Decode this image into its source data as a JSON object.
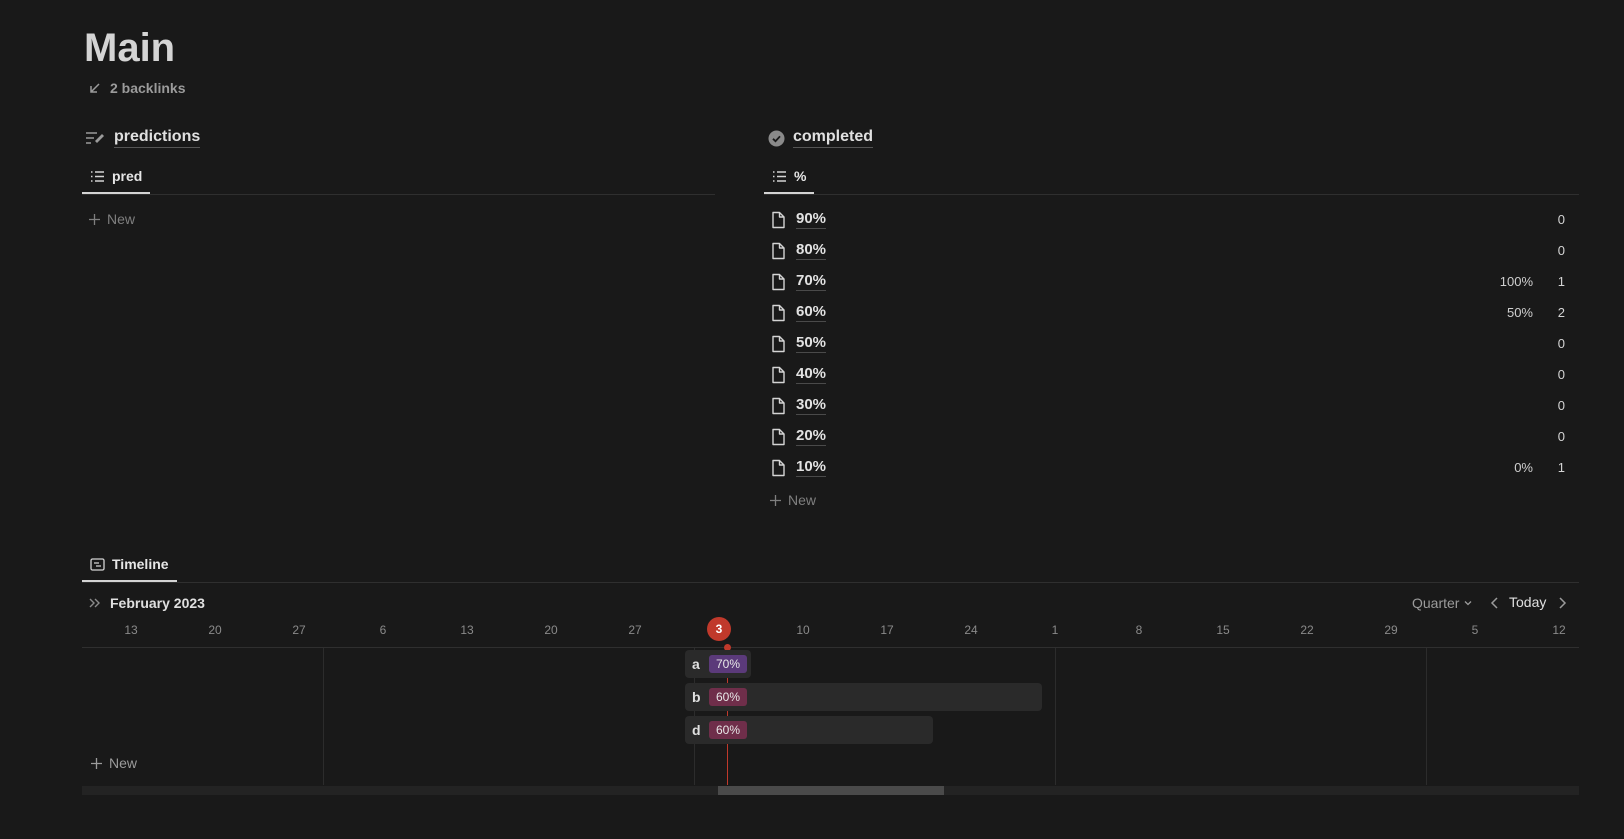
{
  "page": {
    "title": "Main",
    "backlinks": "2 backlinks"
  },
  "predictions": {
    "title": "predictions",
    "tab": "pred",
    "new_label": "New"
  },
  "completed": {
    "title": "completed",
    "tab": "%",
    "new_label": "New",
    "rows": [
      {
        "name": "90%",
        "pct": "",
        "count": "0"
      },
      {
        "name": "80%",
        "pct": "",
        "count": "0"
      },
      {
        "name": "70%",
        "pct": "100%",
        "count": "1"
      },
      {
        "name": "60%",
        "pct": "50%",
        "count": "2"
      },
      {
        "name": "50%",
        "pct": "",
        "count": "0"
      },
      {
        "name": "40%",
        "pct": "",
        "count": "0"
      },
      {
        "name": "30%",
        "pct": "",
        "count": "0"
      },
      {
        "name": "20%",
        "pct": "",
        "count": "0"
      },
      {
        "name": "10%",
        "pct": "0%",
        "count": "1"
      }
    ]
  },
  "timeline": {
    "tab": "Timeline",
    "month": "February 2023",
    "range": "Quarter",
    "today": "Today",
    "today_day": "3",
    "days": [
      "13",
      "20",
      "27",
      "6",
      "13",
      "20",
      "27",
      "3",
      "10",
      "17",
      "24",
      "1",
      "8",
      "15",
      "22",
      "29",
      "5",
      "12"
    ],
    "items": [
      {
        "label": "a",
        "tag": "70%"
      },
      {
        "label": "b",
        "tag": "60%"
      },
      {
        "label": "d",
        "tag": "60%"
      }
    ],
    "new_label": "New"
  },
  "colors": {
    "background": "#191919",
    "accent_red": "#c0392b",
    "tag_purple": "#5b3a7a",
    "tag_pink": "#6f2e4a"
  }
}
